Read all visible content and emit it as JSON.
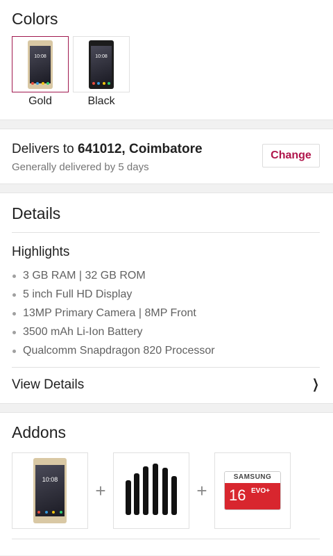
{
  "colors": {
    "title": "Colors",
    "options": [
      {
        "label": "Gold",
        "selected": true
      },
      {
        "label": "Black",
        "selected": false
      }
    ],
    "phone_screen_time": "10:08"
  },
  "delivery": {
    "prefix": "Delivers to ",
    "pincode_city": "641012, Coimbatore",
    "subtitle": "Generally delivered by 5 days",
    "change_label": "Change"
  },
  "details": {
    "title": "Details",
    "highlights_title": "Highlights",
    "highlights": [
      "3 GB RAM  |  32 GB ROM",
      "5 inch Full HD Display",
      "13MP Primary Camera | 8MP Front",
      "3500 mAh Li-Ion Battery",
      "Qualcomm Snapdragon 820 Processor"
    ],
    "view_details_label": "View Details"
  },
  "addons": {
    "title": "Addons",
    "plus": "+",
    "sd_brand": "SAMSUNG",
    "sd_capacity": "16",
    "sd_series": "EVO+"
  },
  "colors_hex": {
    "accent": "#b0154b",
    "selected_border": "#a0184f"
  }
}
